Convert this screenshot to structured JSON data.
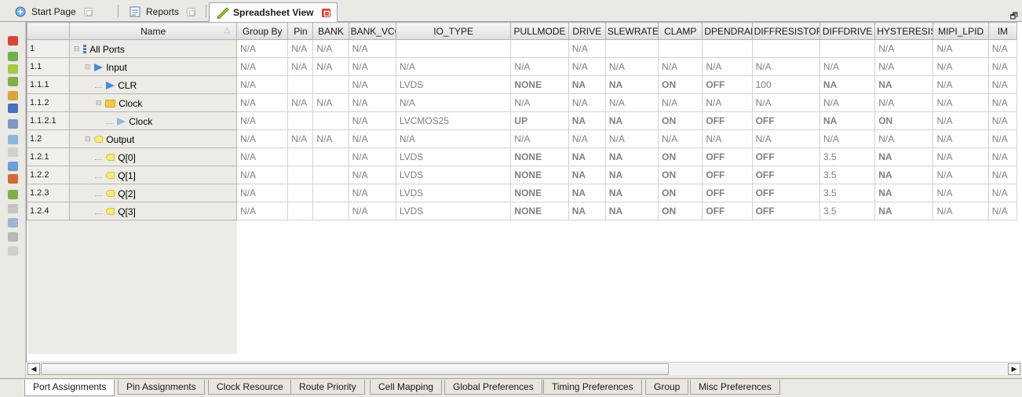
{
  "doc_tabs": [
    {
      "label": "Start Page",
      "active": false
    },
    {
      "label": "Reports",
      "active": false
    },
    {
      "label": "Spreadsheet View",
      "active": true
    }
  ],
  "window_controls": "ȡ ×",
  "columns": [
    "Name",
    "Group By",
    "Pin",
    "BANK",
    "BANK_VCC",
    "IO_TYPE",
    "PULLMODE",
    "DRIVE",
    "SLEWRATE",
    "CLAMP",
    "OPENDRAIN",
    "DIFFRESISTOR",
    "DIFFDRIVE",
    "HYSTERESIS",
    "MIPI_LPID",
    "IM"
  ],
  "columns_display": [
    "Name",
    "Group By",
    "Pin",
    "BANK",
    "BANK_VCC",
    "IO_TYPE",
    "PULLMODE",
    "DRIVE",
    "SLEWRATE",
    "CLAMP",
    "DPENDRAIN",
    "DIFFRESISTOF",
    "DIFFDRIVE",
    "HYSTERESIS",
    "MIPI_LPID",
    "IM"
  ],
  "rows": [
    {
      "id": "1",
      "name": "All Ports",
      "cells": [
        "N/A",
        "N/A",
        "N/A",
        "N/A",
        "",
        "",
        "N/A",
        "",
        "",
        "",
        "",
        "",
        "N/A",
        "N/A",
        "N/A"
      ]
    },
    {
      "id": "1.1",
      "name": "Input",
      "cells": [
        "N/A",
        "N/A",
        "N/A",
        "N/A",
        "N/A",
        "N/A",
        "N/A",
        "N/A",
        "N/A",
        "N/A",
        "N/A",
        "N/A",
        "N/A",
        "N/A",
        "N/A"
      ]
    },
    {
      "id": "1.1.1",
      "name": "CLR",
      "cells": [
        "N/A",
        "",
        "",
        "N/A",
        "LVDS",
        "NONE",
        "NA",
        "NA",
        "ON",
        "OFF",
        "100",
        "NA",
        "NA",
        "N/A",
        "N/A"
      ]
    },
    {
      "id": "1.1.2",
      "name": "Clock",
      "cells": [
        "N/A",
        "N/A",
        "N/A",
        "N/A",
        "N/A",
        "N/A",
        "N/A",
        "N/A",
        "N/A",
        "N/A",
        "N/A",
        "N/A",
        "N/A",
        "N/A",
        "N/A"
      ]
    },
    {
      "id": "1.1.2.1",
      "name": "Clock",
      "cells": [
        "N/A",
        "",
        "",
        "N/A",
        "LVCMOS25",
        "UP",
        "NA",
        "NA",
        "ON",
        "OFF",
        "OFF",
        "NA",
        "ON",
        "N/A",
        "N/A"
      ]
    },
    {
      "id": "1.2",
      "name": "Output",
      "cells": [
        "N/A",
        "N/A",
        "N/A",
        "N/A",
        "N/A",
        "N/A",
        "N/A",
        "N/A",
        "N/A",
        "N/A",
        "N/A",
        "N/A",
        "N/A",
        "N/A",
        "N/A"
      ]
    },
    {
      "id": "1.2.1",
      "name": "Q[0]",
      "cells": [
        "N/A",
        "",
        "",
        "N/A",
        "LVDS",
        "NONE",
        "NA",
        "NA",
        "ON",
        "OFF",
        "OFF",
        "3.5",
        "NA",
        "N/A",
        "N/A"
      ]
    },
    {
      "id": "1.2.2",
      "name": "Q[1]",
      "cells": [
        "N/A",
        "",
        "",
        "N/A",
        "LVDS",
        "NONE",
        "NA",
        "NA",
        "ON",
        "OFF",
        "OFF",
        "3.5",
        "NA",
        "N/A",
        "N/A"
      ]
    },
    {
      "id": "1.2.3",
      "name": "Q[2]",
      "cells": [
        "N/A",
        "",
        "",
        "N/A",
        "LVDS",
        "NONE",
        "NA",
        "NA",
        "ON",
        "OFF",
        "OFF",
        "3.5",
        "NA",
        "N/A",
        "N/A"
      ]
    },
    {
      "id": "1.2.4",
      "name": "Q[3]",
      "cells": [
        "N/A",
        "",
        "",
        "N/A",
        "LVDS",
        "NONE",
        "NA",
        "NA",
        "ON",
        "OFF",
        "OFF",
        "3.5",
        "NA",
        "N/A",
        "N/A"
      ]
    }
  ],
  "sheet_tabs": [
    "Port Assignments",
    "Pin Assignments",
    "Clock Resource",
    "Route Priority",
    "Cell Mapping",
    "Global Preferences",
    "Timing Preferences",
    "Group",
    "Misc Preferences"
  ],
  "active_sheet_tab": "Port Assignments",
  "icons": {
    "tab_start": "start-page-icon",
    "tab_reports": "reports-icon",
    "tab_spreadsheet": "spreadsheet-icon"
  }
}
